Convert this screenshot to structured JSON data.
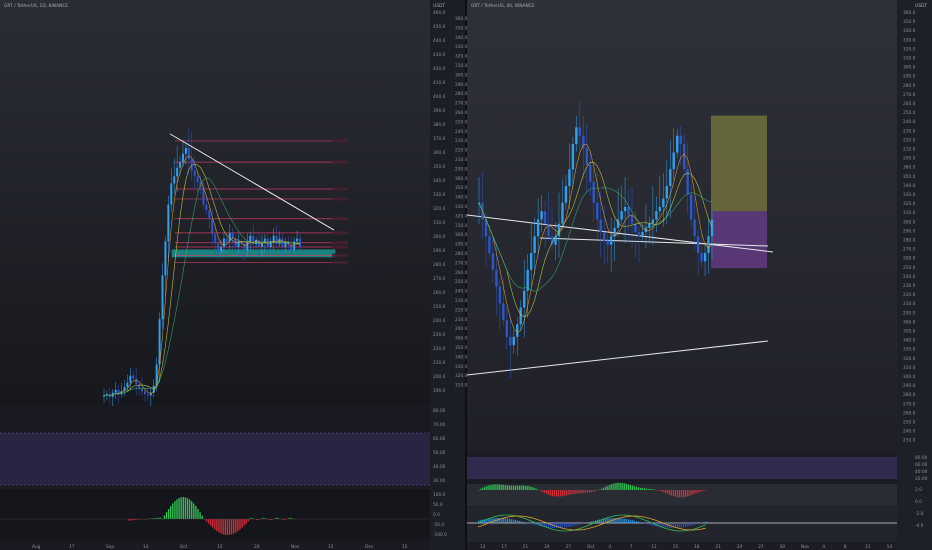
{
  "colors": {
    "bg_top": "#2a2c35",
    "bg_bottom": "#16171c",
    "up": "#2ea0f0",
    "down": "#2d56c8",
    "support": "#19d4c8",
    "resistance": "#e03a6a",
    "trendline": "#e8e8ea",
    "target_zone": "#7a7a3c",
    "stop_zone": "#6a3d8c",
    "rsi_fill": "#3a2d55",
    "hist_up": "#2fbf52",
    "hist_down": "#c8303a",
    "ma_fast": "#e0a030",
    "ma_mid": "#c8d040",
    "ma_slow": "#37a86a",
    "price_tag": "#2b6fe0",
    "yellow_tag": "#e4d640",
    "purple_tag": "#9b3fd0"
  },
  "chart_data": [
    {
      "name": "left-pane",
      "type": "candlestick",
      "symbol": "GRT / TetherUS, 1D, BINANCE",
      "title": "GRT / TetherUS, 1D, BINANCE",
      "currency": "USDT",
      "x_tick_labels": [
        "Aug",
        "17",
        "Sep",
        "14",
        "Oct",
        "15",
        "20",
        "Nov",
        "15",
        "Dec",
        "15"
      ],
      "y_tick_labels": [
        "460.0",
        "450.0",
        "440.0",
        "430.0",
        "420.0",
        "410.0",
        "400.0",
        "390.0",
        "380.0",
        "370.0",
        "360.0",
        "350.0",
        "340.0",
        "330.0",
        "320.0",
        "310.0",
        "300.0",
        "290.0",
        "280.0",
        "270.0",
        "260.0",
        "250.0",
        "240.0",
        "230.0",
        "220.0",
        "210.0",
        "200.0",
        "190.0"
      ],
      "ylim": [
        185,
        465
      ],
      "close_series": [
        191,
        192,
        190,
        193,
        195,
        192,
        194,
        197,
        200,
        205,
        203,
        199,
        196,
        194,
        192,
        191,
        193,
        198,
        213,
        245,
        276,
        300,
        326,
        341,
        346,
        352,
        356,
        362,
        366,
        358,
        350,
        346,
        342,
        338,
        326,
        322,
        316,
        305,
        299,
        293,
        296,
        302,
        300,
        306,
        302,
        296,
        300,
        298,
        294,
        300,
        304,
        298,
        301,
        296,
        299,
        302,
        296,
        300,
        304,
        298,
        302,
        296,
        300,
        297,
        294,
        300,
        302,
        296
      ],
      "resistance_levels": [
        371.0,
        356.0,
        337.0,
        330.0,
        316.0,
        306.0,
        299.0,
        296.0,
        290.0,
        285.0
      ],
      "support_zone": [
        289,
        294
      ],
      "trendline": {
        "from": [
          36,
          376
        ],
        "to": [
          62,
          308
        ]
      },
      "last_price": "299.0"
    },
    {
      "name": "right-pane",
      "type": "candlestick",
      "symbol": "GRT / TetherUS, 4h, BINANCE",
      "title": "GRT / TetherUS, 4h, BINANCE",
      "currency": "USDT",
      "x_tick_labels": [
        "13",
        "17",
        "21",
        "24",
        "27",
        "Oct",
        "4",
        "7",
        "11",
        "15",
        "18",
        "21",
        "24",
        "27",
        "30",
        "Nov",
        "4",
        "8",
        "11",
        "14"
      ],
      "y_tick_labels": [
        "360.0",
        "350.0",
        "340.0",
        "330.0",
        "320.0",
        "310.0",
        "300.0",
        "290.0",
        "280.0",
        "270.0",
        "260.0",
        "250.0",
        "240.0",
        "230.0",
        "220.0",
        "210.0",
        "200.0"
      ],
      "ylim": [
        245,
        350
      ],
      "close_series": [
        304,
        300,
        296,
        292,
        288,
        284,
        280,
        276,
        272,
        270,
        272,
        275,
        279,
        283,
        288,
        292,
        296,
        300,
        302,
        299,
        296,
        294,
        296,
        299,
        304,
        308,
        312,
        318,
        322,
        320,
        317,
        313,
        309,
        304,
        300,
        297,
        295,
        294,
        296,
        298,
        300,
        302,
        303,
        301,
        299,
        297,
        296,
        297,
        298,
        299,
        300,
        302,
        303,
        305,
        308,
        312,
        316,
        320,
        318,
        312,
        306,
        300,
        296,
        292,
        290,
        292,
        296,
        300
      ],
      "target_zone_top": "324.8",
      "stop_zone_bottom": "288.4",
      "last_price": "298.0"
    }
  ],
  "oscillators": {
    "left_rsi_labels": [
      "80.00",
      "70.00",
      "60.00",
      "50.00",
      "40.00",
      "30.00"
    ],
    "left_macd_labels": [
      "100.0",
      "50.0",
      "0.0",
      "-50.0",
      "-100.0"
    ],
    "right_rsi_labels": [
      "80.00",
      "60.00",
      "40.00",
      "20.00"
    ],
    "right_macd_labels": [
      "2.0",
      "0.0",
      "-2.0",
      "-4.0"
    ]
  }
}
